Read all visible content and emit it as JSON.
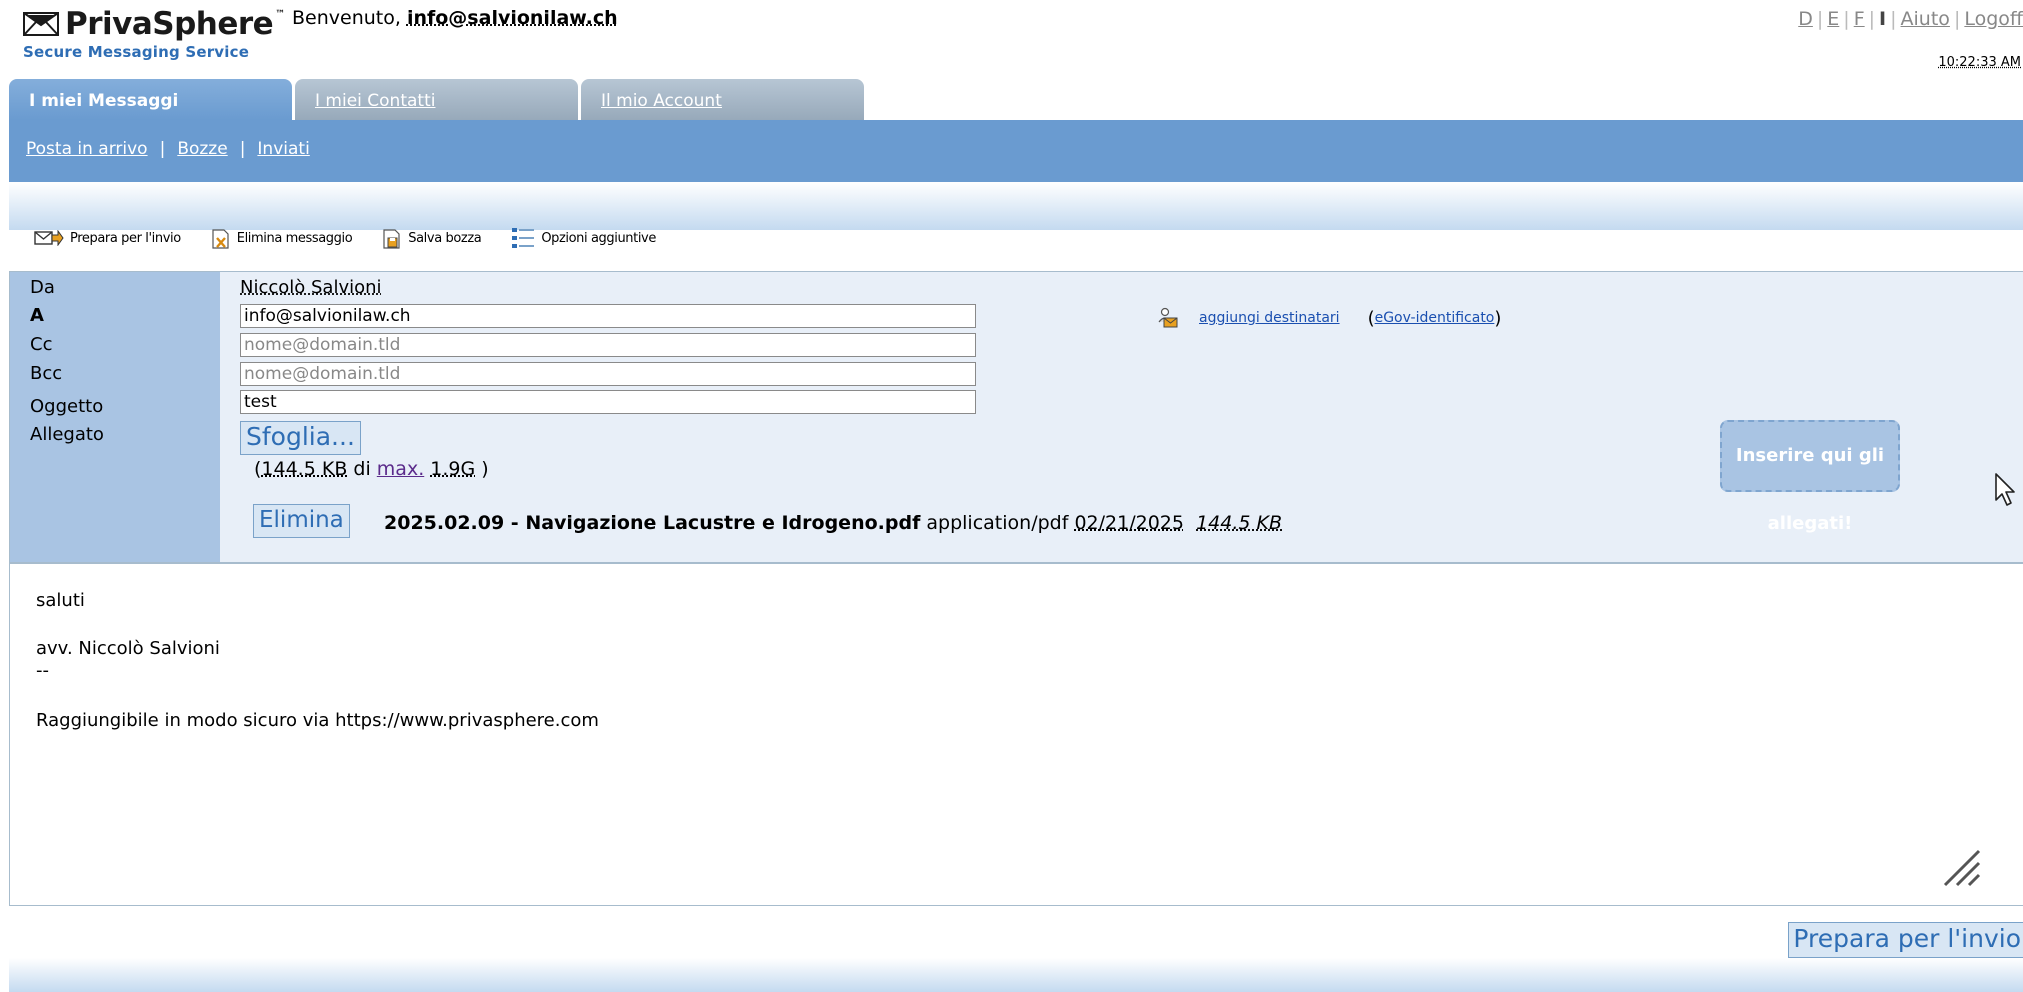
{
  "brand": {
    "name": "PrivaSphere",
    "tm": "™",
    "subtitle": "Secure Messaging Service"
  },
  "header": {
    "welcome_prefix": "Benvenuto,",
    "user": "info@salvionilaw.ch",
    "lang": [
      "D",
      "E",
      "F",
      "I"
    ],
    "help": "Aiuto",
    "logoff": "Logoff",
    "time": "10:22:33 AM"
  },
  "tabs": [
    {
      "label": "I miei Messaggi",
      "active": true
    },
    {
      "label": "I miei Contatti",
      "active": false
    },
    {
      "label": "Il mio Account",
      "active": false
    }
  ],
  "subnav": [
    "Posta in arrivo",
    "Bozze",
    "Inviati"
  ],
  "toolbar": {
    "prepare": "Prepara per l'invio",
    "delete": "Elimina messaggio",
    "save": "Salva bozza",
    "options": "Opzioni aggiuntive"
  },
  "form": {
    "labels": {
      "from": "Da",
      "to": "A",
      "cc": "Cc",
      "bcc": "Bcc",
      "subject": "Oggetto",
      "attachment": "Allegato"
    },
    "from": "Niccolò Salvioni",
    "to": "info@salvionilaw.ch",
    "cc_placeholder": "nome@domain.tld",
    "bcc_placeholder": "nome@domain.tld",
    "subject": "test",
    "browse": "Sfoglia...",
    "quota": {
      "used": "144.5 KB",
      "of": "di",
      "max_label": "max.",
      "max": "1.9G"
    },
    "delete_attachment": "Elimina",
    "attachment": {
      "name": "2025.02.09 - Navigazione Lacustre e Idrogeno.pdf",
      "type": "application/pdf",
      "date": "02/21/2025",
      "size": "144.5 KB"
    },
    "add_recipients": "aggiungi destinatari",
    "egov": "eGov-identificato",
    "drop_zone": "Inserire qui gli allegati!"
  },
  "body": {
    "lines": [
      "saluti",
      "avv. Niccolò Salvioni",
      "--",
      "Raggiungibile in modo sicuro via https://www.privasphere.com"
    ]
  },
  "send_button": "Prepara per l'invio"
}
